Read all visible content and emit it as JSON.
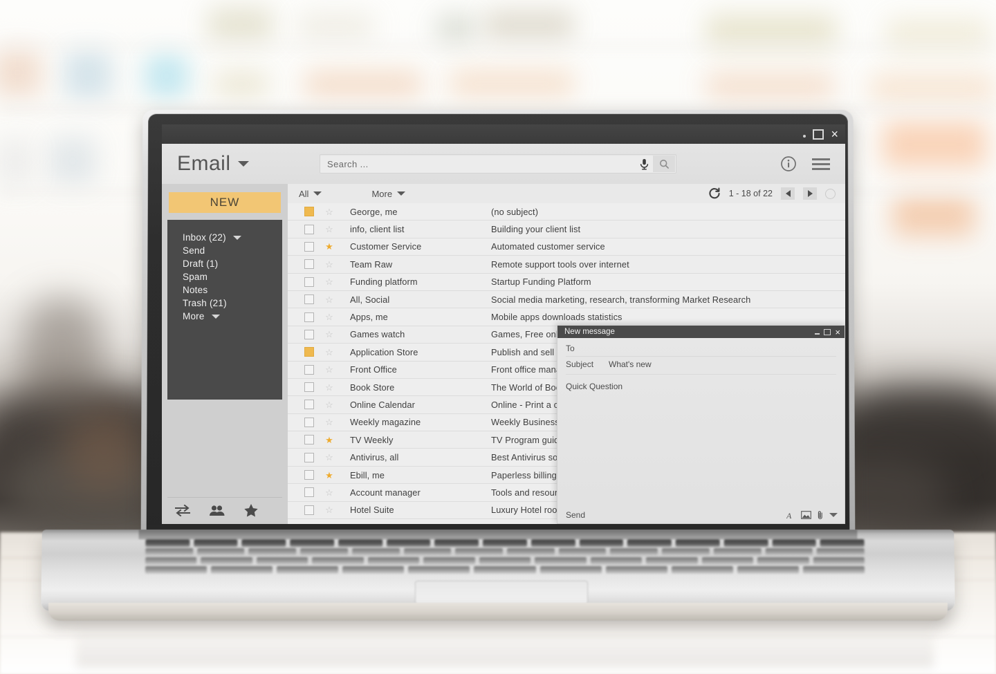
{
  "window": {
    "controls": {
      "minimize": "minimize-dot",
      "maximize": "maximize-square",
      "close": "×"
    }
  },
  "header": {
    "brand_title": "Email",
    "brand_caret_icon": "chevron-down-icon",
    "search": {
      "value": "",
      "placeholder": "Search ...",
      "mic_icon": "microphone-icon",
      "search_icon": "magnifier-icon"
    },
    "info_icon": "info-circle-icon",
    "menu_icon": "hamburger-menu-icon"
  },
  "sidebar": {
    "new_label": "NEW",
    "folders": [
      {
        "label": "Inbox (22)",
        "caret": true
      },
      {
        "label": "Send",
        "caret": false
      },
      {
        "label": "Draft (1)",
        "caret": false
      },
      {
        "label": "Spam",
        "caret": false
      },
      {
        "label": "Notes",
        "caret": false
      },
      {
        "label": "Trash (21)",
        "caret": false
      },
      {
        "label": "More",
        "caret": true
      }
    ],
    "bottom_icons": [
      "exchange-arrows-icon",
      "contacts-people-icon",
      "star-icon"
    ]
  },
  "list_toolbar": {
    "all_label": "All",
    "more_label": "More",
    "all_caret_icon": "chevron-down-icon",
    "more_caret_icon": "chevron-down-icon",
    "refresh_icon": "refresh-icon",
    "range_label": "1 - 18 of 22",
    "prev_icon": "arrow-left-icon",
    "next_icon": "arrow-right-icon",
    "status_circle_icon": "circle-icon"
  },
  "messages": [
    {
      "checked": true,
      "starred": false,
      "sender": "George, me",
      "subject": "(no subject)"
    },
    {
      "checked": false,
      "starred": false,
      "sender": "info, client list",
      "subject": "Building your client list"
    },
    {
      "checked": false,
      "starred": true,
      "sender": "Customer Service",
      "subject": "Automated customer service"
    },
    {
      "checked": false,
      "starred": false,
      "sender": "Team Raw",
      "subject": "Remote support tools over internet"
    },
    {
      "checked": false,
      "starred": false,
      "sender": "Funding platform",
      "subject": "Startup Funding Platform"
    },
    {
      "checked": false,
      "starred": false,
      "sender": "All, Social",
      "subject": "Social media marketing, research, transforming Market Research"
    },
    {
      "checked": false,
      "starred": false,
      "sender": "Apps, me",
      "subject": "Mobile apps downloads statistics"
    },
    {
      "checked": false,
      "starred": false,
      "sender": "Games watch",
      "subject": "Games, Free online games"
    },
    {
      "checked": true,
      "starred": false,
      "sender": "Application Store",
      "subject": "Publish and sell your apps"
    },
    {
      "checked": false,
      "starred": false,
      "sender": "Front Office",
      "subject": "Front office management"
    },
    {
      "checked": false,
      "starred": false,
      "sender": "Book Store",
      "subject": "The World of Books"
    },
    {
      "checked": false,
      "starred": false,
      "sender": "Online Calendar",
      "subject": "Online - Print a calendar"
    },
    {
      "checked": false,
      "starred": false,
      "sender": "Weekly magazine",
      "subject": "Weekly Business magazine"
    },
    {
      "checked": false,
      "starred": true,
      "sender": "TV Weekly",
      "subject": "TV Program guide"
    },
    {
      "checked": false,
      "starred": false,
      "sender": "Antivirus, all",
      "subject": "Best Antivirus software"
    },
    {
      "checked": false,
      "starred": true,
      "sender": "Ebill, me",
      "subject": "Paperless billing"
    },
    {
      "checked": false,
      "starred": false,
      "sender": "Account manager",
      "subject": "Tools and resources"
    },
    {
      "checked": false,
      "starred": false,
      "sender": "Hotel Suite",
      "subject": "Luxury Hotel rooms"
    }
  ],
  "compose": {
    "title": "New message",
    "minimize_icon": "minimize-icon",
    "maximize_icon": "maximize-icon",
    "close_icon": "×",
    "to_label": "To",
    "to_value": "",
    "subject_label": "Subject",
    "subject_value": "What's new",
    "body_value": "Quick Question",
    "send_label": "Send",
    "footer_icons": [
      "format-text-icon",
      "insert-image-icon",
      "attachment-paperclip-icon",
      "more-options-caret-icon"
    ]
  },
  "colors": {
    "accent": "#f2c674",
    "star_on": "#eeab2e",
    "sidebar_dark": "#4a4a4a",
    "sidebar_light": "#cfcfcf",
    "titlebar": "#3b3b3b",
    "list_bg": "#ededed"
  }
}
